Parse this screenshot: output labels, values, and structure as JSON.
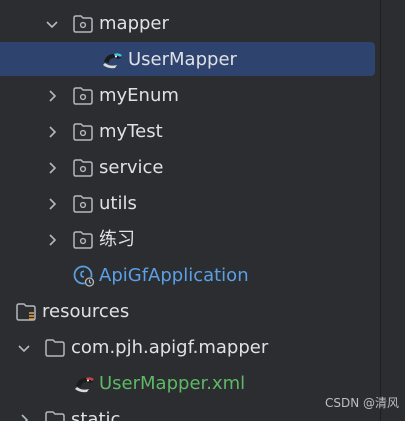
{
  "tree": {
    "items": [
      {
        "label": "mapper",
        "expanded": true,
        "kind": "package"
      },
      {
        "label": "UserMapper",
        "kind": "mybatis-interface",
        "selected": true
      },
      {
        "label": "myEnum",
        "expanded": false,
        "kind": "package"
      },
      {
        "label": "myTest",
        "expanded": false,
        "kind": "package"
      },
      {
        "label": "service",
        "expanded": false,
        "kind": "package"
      },
      {
        "label": "utils",
        "expanded": false,
        "kind": "package"
      },
      {
        "label": "练习",
        "expanded": false,
        "kind": "package"
      },
      {
        "label": "ApiGfApplication",
        "kind": "spring-boot-application"
      },
      {
        "label": "resources",
        "kind": "resources-root"
      },
      {
        "label": "com.pjh.apigf.mapper",
        "expanded": true,
        "kind": "folder"
      },
      {
        "label": "UserMapper.xml",
        "kind": "mybatis-xml"
      },
      {
        "label": "static",
        "expanded": false,
        "kind": "folder"
      }
    ]
  },
  "colors": {
    "background": "#2b2d30",
    "selection": "#2e436e",
    "text": "#dfe1e5",
    "xml_file_text": "#5fb865",
    "app_class_text": "#5aa0e6"
  },
  "watermark": "CSDN @清风"
}
